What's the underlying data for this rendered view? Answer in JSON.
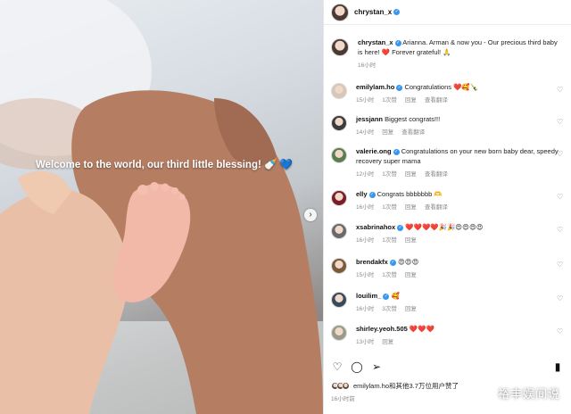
{
  "photo": {
    "caption": "Welcome to the world, our third little blessing! 🍼 💙",
    "next_icon": "›"
  },
  "header": {
    "username": "chrystan_x",
    "verified": "✓"
  },
  "caption": {
    "username": "chrystan_x",
    "text": "Arianna. Arman & now you - Our precious third baby is here! ❤️ Forever grateful! 🙏",
    "time": "16小时"
  },
  "comments": [
    {
      "username": "emilylam.ho",
      "verified": true,
      "text": "Congratulations ❤️🥰🍾",
      "time": "15小时",
      "likes": "1次赞",
      "reply": "回复",
      "translate": "查看翻译"
    },
    {
      "username": "jessjann",
      "verified": false,
      "text": "Biggest congrats!!!",
      "time": "14小时",
      "likes": "",
      "reply": "回复",
      "translate": "查看翻译"
    },
    {
      "username": "valerie.ong",
      "verified": true,
      "text": "Congratulations on your new born baby dear, speedy recovery super mama",
      "time": "12小时",
      "likes": "1次赞",
      "reply": "回复",
      "translate": "查看翻译"
    },
    {
      "username": "elly",
      "verified": true,
      "text": "Congrats bbbbbbb 🫶",
      "time": "16小时",
      "likes": "1次赞",
      "reply": "回复",
      "translate": "查看翻译"
    },
    {
      "username": "xsabrinahox",
      "verified": true,
      "text": "❤️❤️❤️❤️🎉🎉😍😍😍😍",
      "time": "16小时",
      "likes": "1次赞",
      "reply": "回复",
      "translate": ""
    },
    {
      "username": "brendakfx",
      "verified": true,
      "text": "😍😍😍",
      "time": "15小时",
      "likes": "1次赞",
      "reply": "回复",
      "translate": ""
    },
    {
      "username": "louilim_",
      "verified": true,
      "text": "🥰",
      "time": "16小时",
      "likes": "3次赞",
      "reply": "回复",
      "translate": ""
    },
    {
      "username": "shirley.yeoh.505",
      "verified": false,
      "text": "❤️❤️❤️",
      "time": "13小时",
      "likes": "",
      "reply": "回复",
      "translate": ""
    }
  ],
  "actions": {
    "like_icon": "♡",
    "comment_icon": "◯",
    "share_icon": "➢",
    "save_icon": "▮"
  },
  "likes_text": "emilylam.ho和其他3.7万位用户赞了",
  "post_time": "16小时前",
  "watermark": "裕丰娱间说",
  "colors": {
    "verified_blue": "#3797f0",
    "meta_gray": "#8a8a8a",
    "border": "#e6e6e6"
  }
}
